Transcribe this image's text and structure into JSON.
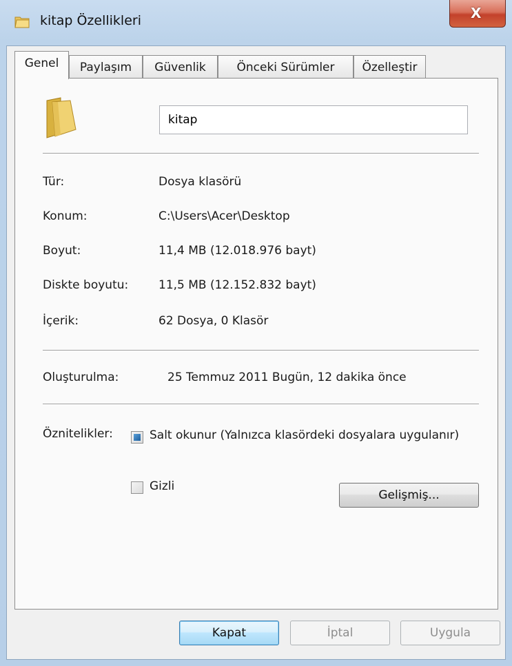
{
  "window": {
    "title": "kitap Özellikleri",
    "close_glyph": "X",
    "icons": {
      "title": "folder-icon",
      "close": "close-icon"
    },
    "colors": {
      "close_button": "#c3412b",
      "frame": "#b9d1ea",
      "default_button": "#3c7fb1"
    }
  },
  "tabs": [
    {
      "label": "Genel",
      "active": true
    },
    {
      "label": "Paylaşım",
      "active": false
    },
    {
      "label": "Güvenlik",
      "active": false
    },
    {
      "label": "Önceki Sürümler",
      "active": false
    },
    {
      "label": "Özelleştir",
      "active": false
    }
  ],
  "general": {
    "folder_name": "kitap",
    "folder_icon": "folder-icon",
    "properties": [
      {
        "label": "Tür:",
        "value": "Dosya klasörü"
      },
      {
        "label": "Konum:",
        "value": "C:\\Users\\Acer\\Desktop"
      },
      {
        "label": "Boyut:",
        "value": "11,4 MB (12.018.976 bayt)"
      },
      {
        "label": "Diskte boyutu:",
        "value": "11,5 MB (12.152.832 bayt)"
      },
      {
        "label": "İçerik:",
        "value": "62 Dosya, 0 Klasör"
      }
    ],
    "created": {
      "label": "Oluşturulma:",
      "value": "25 Temmuz 2011 Bugün, 12 dakika önce"
    },
    "attributes": {
      "label": "Öznitelikler:",
      "readonly": {
        "label": "Salt okunur (Yalnızca klasördeki dosyalara uygulanır)",
        "state": "indeterminate"
      },
      "hidden": {
        "label": "Gizli",
        "state": "unchecked"
      },
      "advanced_button": "Gelişmiş..."
    }
  },
  "footer": {
    "ok": "Kapat",
    "cancel": "İptal",
    "apply": "Uygula"
  }
}
